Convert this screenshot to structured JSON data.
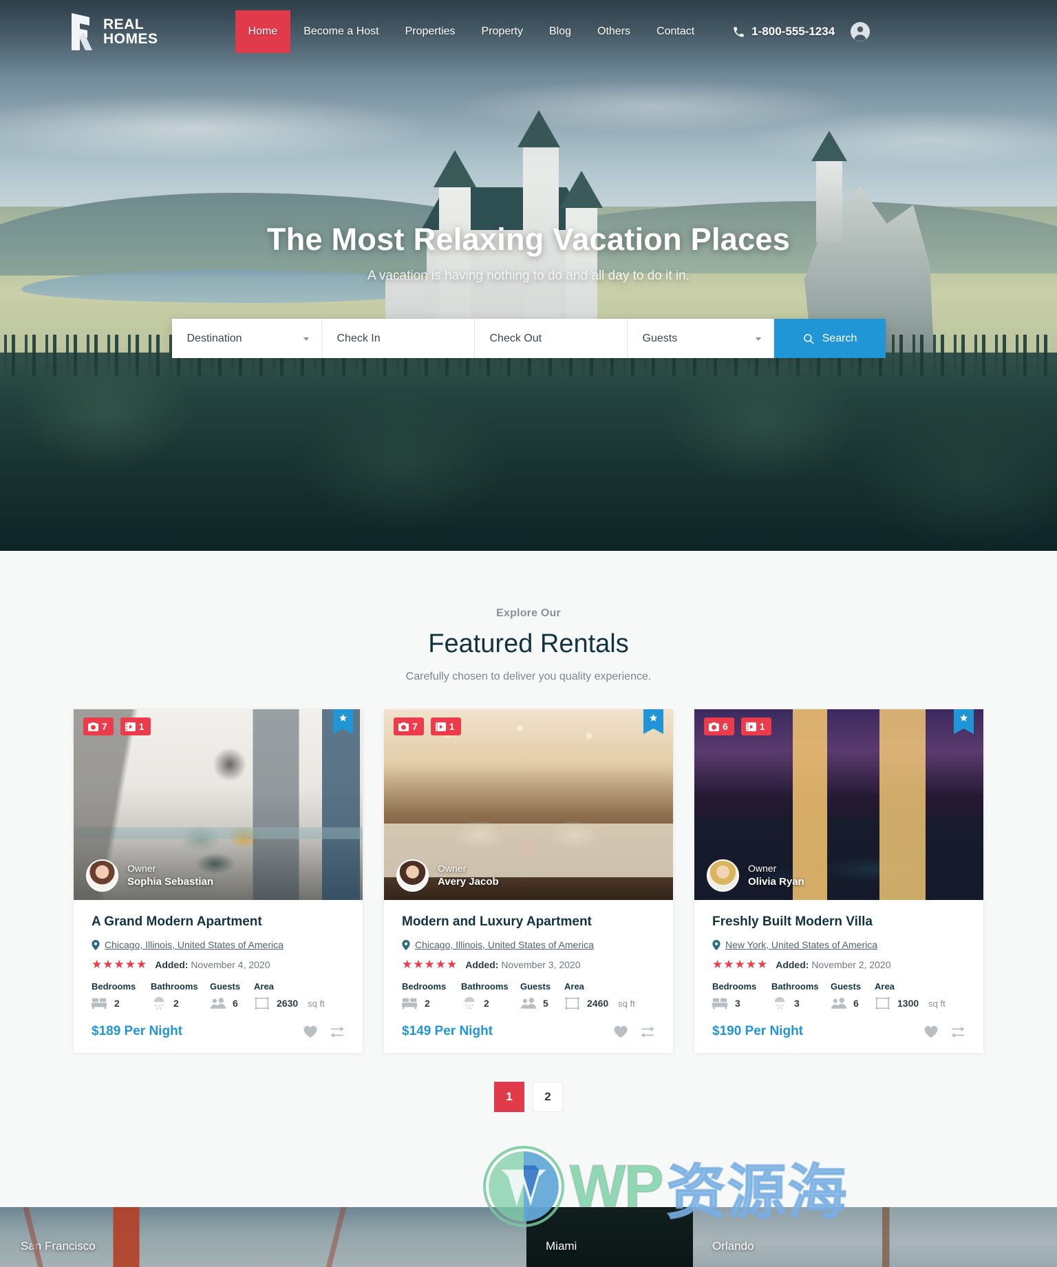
{
  "header": {
    "logo": {
      "line1": "REAL",
      "line2": "HOMES",
      "icon": "real-homes-logo-icon"
    },
    "nav": [
      {
        "label": "Home",
        "active": true
      },
      {
        "label": "Become a Host",
        "active": false
      },
      {
        "label": "Properties",
        "active": false
      },
      {
        "label": "Property",
        "active": false
      },
      {
        "label": "Blog",
        "active": false
      },
      {
        "label": "Others",
        "active": false
      },
      {
        "label": "Contact",
        "active": false
      }
    ],
    "phone": "1-800-555-1234",
    "phone_icon": "phone-icon",
    "account_icon": "user-account-icon"
  },
  "hero": {
    "title": "The Most Relaxing Vacation Places",
    "subtitle": "A vacation is having nothing to do and all day to do it in."
  },
  "search": {
    "destination_placeholder": "Destination",
    "checkin_placeholder": "Check In",
    "checkout_placeholder": "Check Out",
    "guests_placeholder": "Guests",
    "button_label": "Search",
    "button_icon": "search-icon",
    "button_color": "#2196d6"
  },
  "featured": {
    "eyebrow": "Explore Our",
    "title": "Featured Rentals",
    "description": "Carefully chosen to deliver you quality experience.",
    "spec_headers": {
      "bedrooms": "Bedrooms",
      "bathrooms": "Bathrooms",
      "guests": "Guests",
      "area": "Area"
    },
    "added_label": "Added:",
    "area_unit": "sq ft",
    "cards": [
      {
        "title": "A Grand Modern Apartment",
        "location": "Chicago, Illinois, United States of America",
        "stars": "★★★★★",
        "added": "November 4, 2020",
        "bedrooms": "2",
        "bathrooms": "2",
        "guests": "6",
        "area": "2630",
        "price": "$189 Per Night",
        "photo_count": "7",
        "video_count": "1",
        "owner_role": "Owner",
        "owner_name": "Sophia Sebastian"
      },
      {
        "title": "Modern and Luxury Apartment",
        "location": "Chicago, Illinois, United States of America",
        "stars": "★★★★★",
        "added": "November 3, 2020",
        "bedrooms": "2",
        "bathrooms": "2",
        "guests": "5",
        "area": "2460",
        "price": "$149 Per Night",
        "photo_count": "7",
        "video_count": "1",
        "owner_role": "Owner",
        "owner_name": "Avery Jacob"
      },
      {
        "title": "Freshly Built Modern Villa",
        "location": "New York, United States of America",
        "stars": "★★★★★",
        "added": "November 2, 2020",
        "bedrooms": "3",
        "bathrooms": "3",
        "guests": "6",
        "area": "1300",
        "price": "$190 Per Night",
        "photo_count": "6",
        "video_count": "1",
        "owner_role": "Owner",
        "owner_name": "Olivia Ryan"
      }
    ]
  },
  "pagination": {
    "pages": [
      {
        "label": "1",
        "active": true
      },
      {
        "label": "2",
        "active": false
      }
    ]
  },
  "cities": [
    {
      "name": "San Francisco"
    },
    {
      "name": "Miami"
    },
    {
      "name": "Orlando"
    }
  ],
  "watermark": {
    "wp": "WP",
    "cn": "资源海",
    "logo_icon": "wordpress-logo-icon"
  },
  "colors": {
    "accent_red": "#e03a4b",
    "badge_red": "#ec3c4c",
    "accent_blue": "#2196d6",
    "title_dark": "#12333f"
  }
}
